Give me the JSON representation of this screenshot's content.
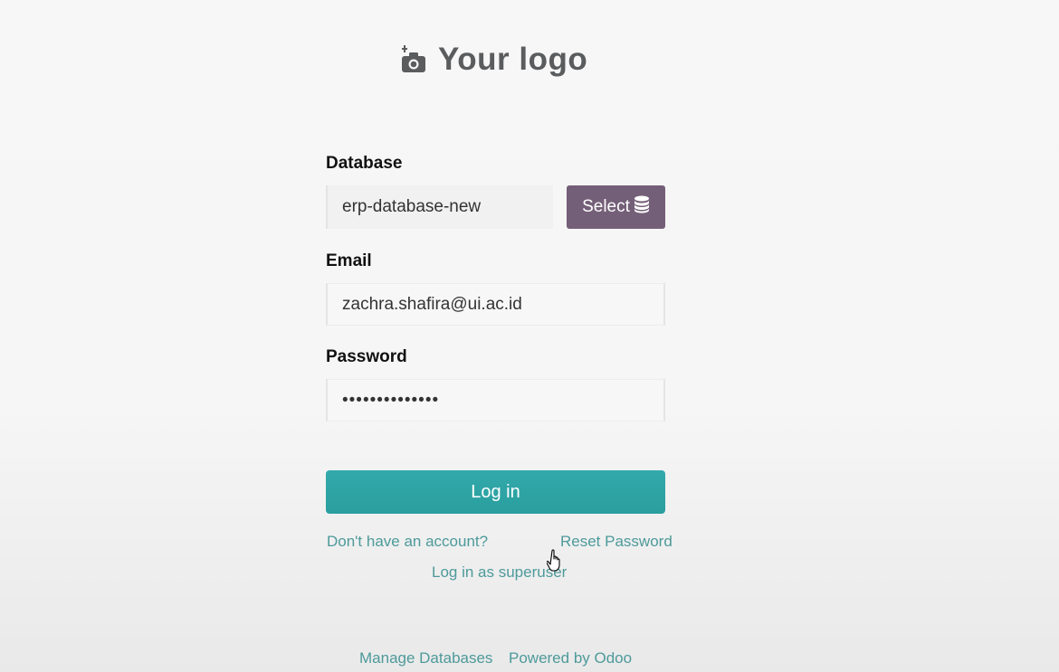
{
  "logo": {
    "text": "Your logo",
    "icon": "add-camera-icon"
  },
  "form": {
    "database_label": "Database",
    "database_value": "erp-database-new",
    "select_label": "Select",
    "select_icon": "database-icon",
    "email_label": "Email",
    "email_value": "zachra.shafira@ui.ac.id",
    "password_label": "Password",
    "password_masked": "••••••••••••••",
    "login_label": "Log in"
  },
  "links": {
    "signup": "Don't have an account?",
    "reset": "Reset Password",
    "superuser": "Log in as superuser",
    "manage": "Manage Databases",
    "powered": "Powered by Odoo"
  },
  "colors": {
    "primary": "#2ea3a5",
    "select_button": "#745f78",
    "link": "#4e9a9a"
  }
}
